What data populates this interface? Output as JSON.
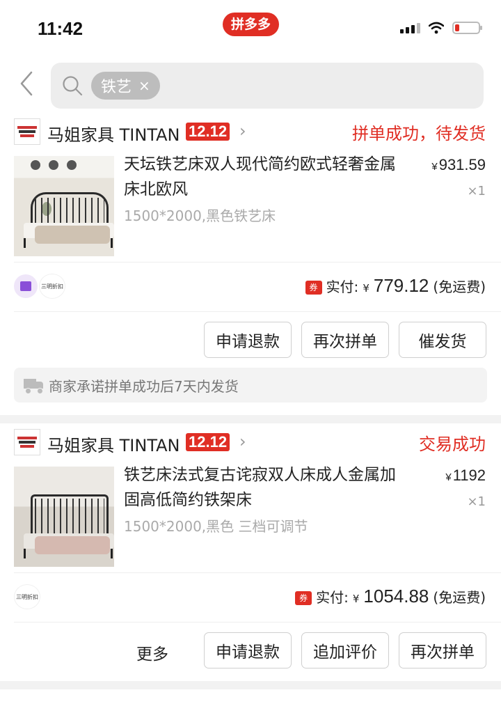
{
  "status_bar": {
    "time": "11:42",
    "app_badge": "拼多多",
    "icons": [
      "signal-icon",
      "wifi-icon",
      "battery-low-icon"
    ]
  },
  "search": {
    "chip_label": "铁艺",
    "chip_close": "×",
    "icons": [
      "back-arrow-icon",
      "search-icon"
    ]
  },
  "orders": [
    {
      "shop_name": "马姐家具 TINTAN",
      "promo_tag": "12.12",
      "status": "拼单成功，待发货",
      "product_title": "天坛铁艺床双人现代简约欧式轻奢金属床北欧风",
      "spec": "1500*2000,黑色铁艺床",
      "price_currency": "¥",
      "price": "931.59",
      "quantity": "×1",
      "coupon_badge": "券",
      "pay_label": "实付:",
      "pay_currency": "¥",
      "pay_amount": "779.12",
      "shipping": "(免运费)",
      "promo_text": "三明折扣",
      "buttons": [
        "申请退款",
        "再次拼单",
        "催发货"
      ],
      "notice": "商家承诺拼单成功后7天内发货"
    },
    {
      "shop_name": "马姐家具 TINTAN",
      "promo_tag": "12.12",
      "status": "交易成功",
      "product_title": "铁艺床法式复古诧寂双人床成人金属加固高低简约铁架床",
      "spec": "1500*2000,黑色 三档可调节",
      "price_currency": "¥",
      "price": "1192",
      "quantity": "×1",
      "coupon_badge": "券",
      "pay_label": "实付:",
      "pay_currency": "¥",
      "pay_amount": "1054.88",
      "shipping": "(免运费)",
      "promo_text": "三明折扣",
      "more_label": "更多",
      "buttons": [
        "申请退款",
        "追加评价",
        "再次拼单"
      ]
    }
  ],
  "colors": {
    "accent": "#e02e24",
    "muted_text": "#aaaaaa",
    "search_bg": "#ededed"
  }
}
